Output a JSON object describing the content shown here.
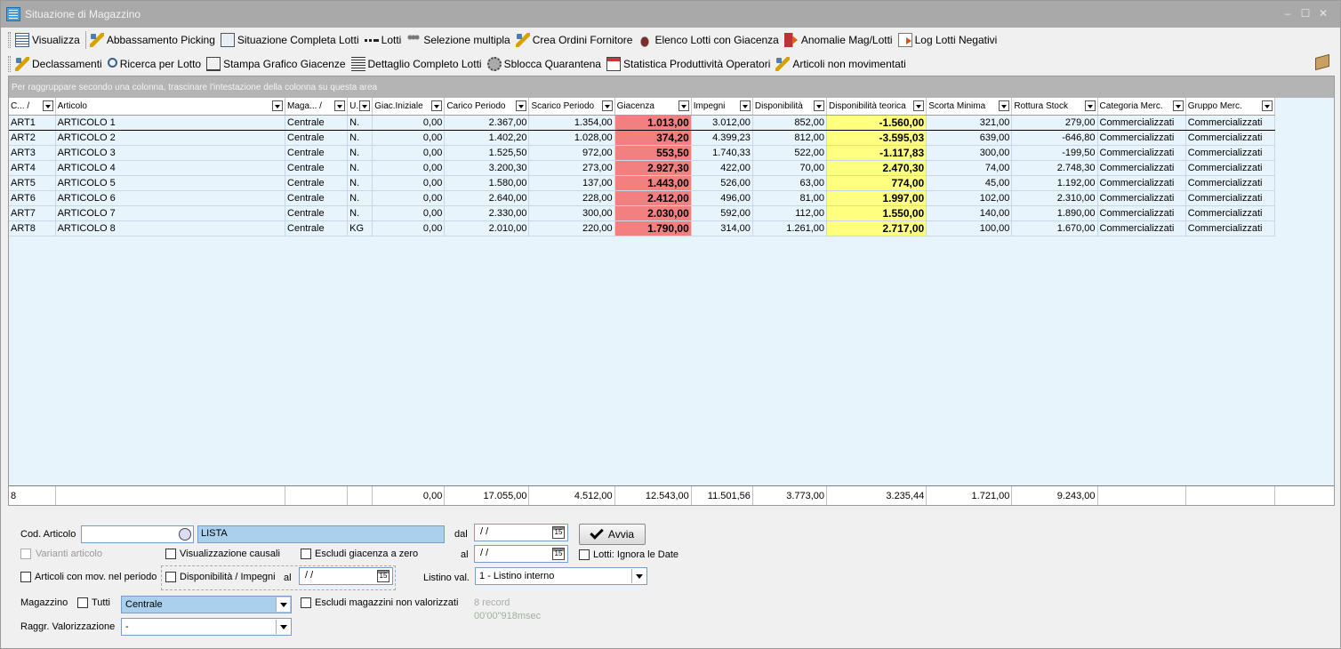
{
  "window": {
    "title": "Situazione di Magazzino"
  },
  "toolbar1": [
    {
      "label": "Visualizza",
      "icon": "grid-icon"
    },
    {
      "label": "Abbassamento Picking",
      "icon": "pencil-icon"
    },
    {
      "label": "Situazione Completa Lotti",
      "icon": "document-icon"
    },
    {
      "label": "Lotti",
      "icon": "dots-icon"
    },
    {
      "label": "Selezione multipla",
      "icon": "people-icon"
    },
    {
      "label": "Crea Ordini Fornitore",
      "icon": "pencil-icon"
    },
    {
      "label": "Elenco Lotti con Giacenza",
      "icon": "bottle-icon"
    },
    {
      "label": "Anomalie Mag/Lotti",
      "icon": "arrow-icon"
    },
    {
      "label": "Log Lotti Negativi",
      "icon": "log-icon"
    }
  ],
  "toolbar2": [
    {
      "label": "Declassamenti",
      "icon": "pencil-icon"
    },
    {
      "label": "Ricerca per Lotto",
      "icon": "search-icon"
    },
    {
      "label": "Stampa Grafico Giacenze",
      "icon": "chart-icon"
    },
    {
      "label": "Dettaglio Completo Lotti",
      "icon": "lines-icon"
    },
    {
      "label": "Sblocca Quarantena",
      "icon": "gear-icon"
    },
    {
      "label": "Statistica Produttività Operatori",
      "icon": "calendar-icon"
    },
    {
      "label": "Articoli non movimentati",
      "icon": "pencil-icon"
    }
  ],
  "grid": {
    "group_hint": "Per raggruppare secondo una colonna, trascinare l'intestazione della colonna su questa area",
    "columns": [
      "C... /",
      "Articolo",
      "Maga... /",
      "U.",
      "Giac.Iniziale",
      "Carico Periodo",
      "Scarico Periodo",
      "Giacenza",
      "Impegni",
      "Disponibilità",
      "Disponibilità teorica",
      "Scorta Minima",
      "Rottura Stock",
      "Categoria Merc.",
      "Gruppo Merc."
    ],
    "rows": [
      [
        "ART1",
        "ARTICOLO 1",
        "Centrale",
        "N.",
        "0,00",
        "2.367,00",
        "1.354,00",
        "1.013,00",
        "3.012,00",
        "852,00",
        "-1.560,00",
        "321,00",
        "279,00",
        "Commercializzati",
        "Commercializzati"
      ],
      [
        "ART2",
        "ARTICOLO 2",
        "Centrale",
        "N.",
        "0,00",
        "1.402,20",
        "1.028,00",
        "374,20",
        "4.399,23",
        "812,00",
        "-3.595,03",
        "639,00",
        "-646,80",
        "Commercializzati",
        "Commercializzati"
      ],
      [
        "ART3",
        "ARTICOLO 3",
        "Centrale",
        "N.",
        "0,00",
        "1.525,50",
        "972,00",
        "553,50",
        "1.740,33",
        "522,00",
        "-1.117,83",
        "300,00",
        "-199,50",
        "Commercializzati",
        "Commercializzati"
      ],
      [
        "ART4",
        "ARTICOLO 4",
        "Centrale",
        "N.",
        "0,00",
        "3.200,30",
        "273,00",
        "2.927,30",
        "422,00",
        "70,00",
        "2.470,30",
        "74,00",
        "2.748,30",
        "Commercializzati",
        "Commercializzati"
      ],
      [
        "ART5",
        "ARTICOLO 5",
        "Centrale",
        "N.",
        "0,00",
        "1.580,00",
        "137,00",
        "1.443,00",
        "526,00",
        "63,00",
        "774,00",
        "45,00",
        "1.192,00",
        "Commercializzati",
        "Commercializzati"
      ],
      [
        "ART6",
        "ARTICOLO 6",
        "Centrale",
        "N.",
        "0,00",
        "2.640,00",
        "228,00",
        "2.412,00",
        "496,00",
        "81,00",
        "1.997,00",
        "102,00",
        "2.310,00",
        "Commercializzati",
        "Commercializzati"
      ],
      [
        "ART7",
        "ARTICOLO 7",
        "Centrale",
        "N.",
        "0,00",
        "2.330,00",
        "300,00",
        "2.030,00",
        "592,00",
        "112,00",
        "1.550,00",
        "140,00",
        "1.890,00",
        "Commercializzati",
        "Commercializzati"
      ],
      [
        "ART8",
        "ARTICOLO 8",
        "Centrale",
        "KG",
        "0,00",
        "2.010,00",
        "220,00",
        "1.790,00",
        "314,00",
        "1.261,00",
        "2.717,00",
        "100,00",
        "1.670,00",
        "Commercializzati",
        "Commercializzati"
      ]
    ],
    "footer": [
      "8",
      "",
      "",
      "",
      "0,00",
      "17.055,00",
      "4.512,00",
      "12.543,00",
      "11.501,56",
      "3.773,00",
      "3.235,44",
      "1.721,00",
      "9.243,00",
      "",
      ""
    ],
    "colors": {
      "giacenza": "#f28080",
      "teorica": "#ffff80",
      "row_bg": "#e8f4fb"
    }
  },
  "filters": {
    "cod_articolo_label": "Cod. Articolo",
    "cod_articolo_value": "",
    "lista_value": "LISTA",
    "dal_label": "dal",
    "date1": " / /",
    "al_label": "al",
    "date2": " / /",
    "date3": " / /",
    "avvia_label": "Avvia",
    "varianti_label": "Varianti articolo",
    "vis_causali_label": "Visualizzazione causali",
    "escludi_giacenza_label": "Escludi giacenza a zero",
    "lotti_ignora_label": "Lotti: Ignora le Date",
    "articoli_mov_label": "Articoli con mov. nel periodo",
    "disp_impegni_label": "Disponibilità / Impegni",
    "al2_label": "al",
    "listino_label": "Listino val.",
    "listino_value": "1 - Listino interno",
    "magazzino_label": "Magazzino",
    "tutti_label": "Tutti",
    "magazzino_value": "Centrale",
    "escludi_mag_label": "Escludi magazzini non valorizzati",
    "records_text": "8 record",
    "time_text": "00'00\"918msec",
    "raggr_label": "Raggr. Valorizzazione",
    "raggr_value": "-"
  }
}
